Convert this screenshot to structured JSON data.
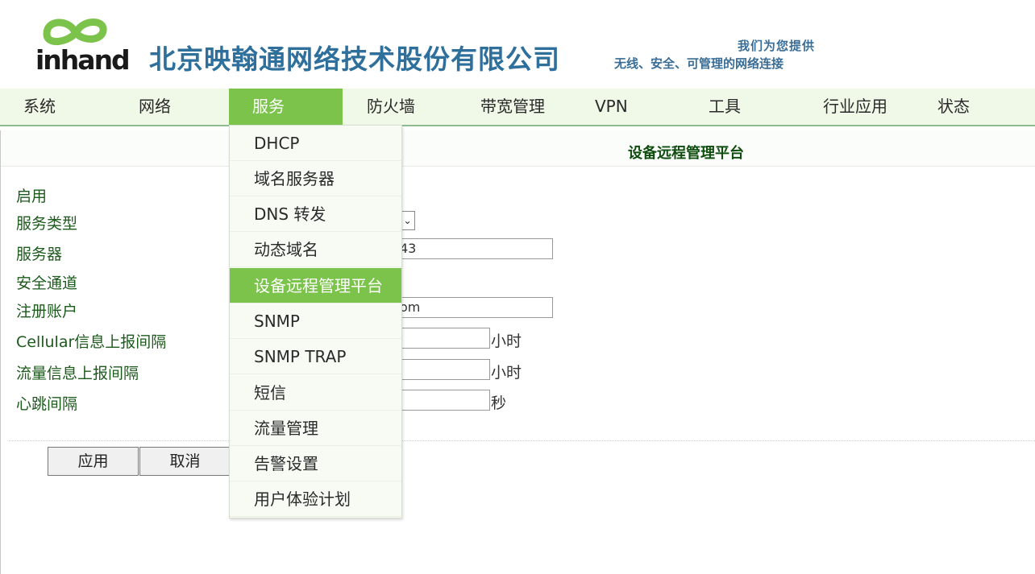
{
  "header": {
    "logo_text": "inhand",
    "company_name": "北京映翰通网络技术股份有限公司",
    "slogan_line1": "我们为您提供",
    "slogan_line2": "无线、安全、可管理的网络连接"
  },
  "nav": {
    "items": [
      {
        "label": "系统"
      },
      {
        "label": "网络"
      },
      {
        "label": "服务",
        "active": true
      },
      {
        "label": "防火墙"
      },
      {
        "label": "带宽管理"
      },
      {
        "label": "VPN"
      },
      {
        "label": "工具"
      },
      {
        "label": "行业应用"
      },
      {
        "label": "状态"
      }
    ]
  },
  "dropdown": {
    "items": [
      {
        "label": "DHCP"
      },
      {
        "label": "域名服务器"
      },
      {
        "label": "DNS 转发"
      },
      {
        "label": "动态域名"
      },
      {
        "label": "设备远程管理平台",
        "active": true
      },
      {
        "label": "SNMP"
      },
      {
        "label": "SNMP TRAP"
      },
      {
        "label": "短信"
      },
      {
        "label": "流量管理"
      },
      {
        "label": "告警设置"
      },
      {
        "label": "用户体验计划"
      }
    ]
  },
  "page": {
    "title": "设备远程管理平台",
    "fields": [
      {
        "label": "启用"
      },
      {
        "label": "服务类型"
      },
      {
        "label": "服务器",
        "value_visible": "43"
      },
      {
        "label": "安全通道"
      },
      {
        "label": "注册账户",
        "value_visible": "om"
      },
      {
        "label": "Cellular信息上报间隔",
        "unit": "小时"
      },
      {
        "label": "流量信息上报间隔",
        "unit": "小时"
      },
      {
        "label": "心跳间隔",
        "unit": "秒"
      }
    ],
    "apply_label": "应用",
    "cancel_label": "取消"
  },
  "colors": {
    "nav_bg": "#f0f8e8",
    "accent_green": "#7bc34b",
    "company_blue": "#2f6f9c",
    "title_green": "#0f4d0f"
  }
}
